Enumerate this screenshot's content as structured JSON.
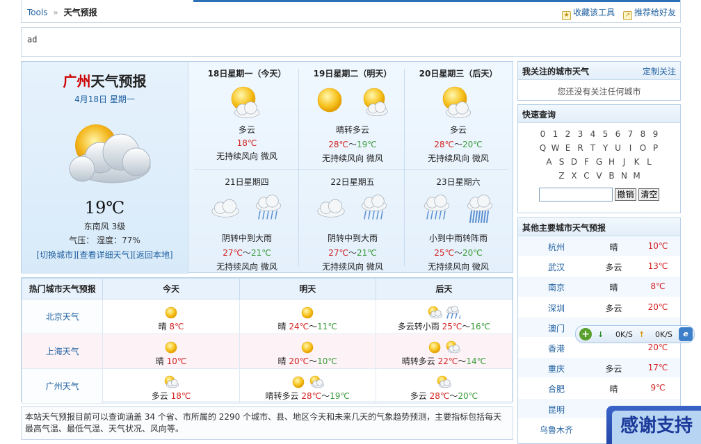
{
  "breadcrumb": {
    "root": "Tools",
    "sep": "»",
    "current": "天气预报"
  },
  "toolbox": {
    "bookmark": "收藏该工具",
    "recommend": "推荐给好友"
  },
  "ad": {
    "text": "ad"
  },
  "today": {
    "city": "广州",
    "title_suffix": "天气预报",
    "date": "4月18日 星期一",
    "icon": "partly-cloudy-icon",
    "temp": "19℃",
    "wind": "东南风 3级",
    "pressure": "气压：",
    "humidity": "湿度：77%",
    "links": "[切换城市][查看详细天气][返回本地]"
  },
  "forecast": [
    {
      "day": "18日星期一（今天）",
      "icon": "sun-cloud",
      "desc": "多云",
      "hi": "18℃",
      "lo": "",
      "wind": "无持续风向 微风"
    },
    {
      "day": "19日星期二（明天）",
      "icon": "sun-and-suncloud",
      "desc": "晴转多云",
      "hi": "28℃",
      "lo": "19℃",
      "wind": "无持续风向 微风"
    },
    {
      "day": "20日星期三（后天）",
      "icon": "sun-cloud",
      "desc": "多云",
      "hi": "28℃",
      "lo": "20℃",
      "wind": "无持续风向 微风"
    },
    {
      "day": "21日星期四",
      "icon": "cloud-rain",
      "desc": "阴转中到大雨",
      "hi": "27℃",
      "lo": "21℃",
      "wind": "无持续风向 微风"
    },
    {
      "day": "22日星期五",
      "icon": "cloud-rain",
      "desc": "阴转中到大雨",
      "hi": "27℃",
      "lo": "21℃",
      "wind": "无持续风向 微风"
    },
    {
      "day": "23日星期六",
      "icon": "rain-heavyrain",
      "desc": "小到中雨转阵雨",
      "hi": "25℃",
      "lo": "20℃",
      "wind": "无持续风向 微风"
    }
  ],
  "hot": {
    "headers": [
      "热门城市天气预报",
      "今天",
      "明天",
      "后天"
    ],
    "rows": [
      {
        "city": "北京天气",
        "today": {
          "desc": "晴",
          "hi": "8℃",
          "lo": ""
        },
        "tomorrow": {
          "desc": "晴",
          "hi": "24℃",
          "lo": "11℃"
        },
        "after": {
          "desc": "多云转小雨",
          "hi": "25℃",
          "lo": "16℃"
        }
      },
      {
        "city": "上海天气",
        "today": {
          "desc": "晴",
          "hi": "10℃",
          "lo": ""
        },
        "tomorrow": {
          "desc": "晴",
          "hi": "20℃",
          "lo": "10℃"
        },
        "after": {
          "desc": "晴转多云",
          "hi": "22℃",
          "lo": "14℃"
        }
      },
      {
        "city": "广州天气",
        "today": {
          "desc": "多云",
          "hi": "18℃",
          "lo": ""
        },
        "tomorrow": {
          "desc": "晴转多云",
          "hi": "28℃",
          "lo": "19℃"
        },
        "after": {
          "desc": "多云",
          "hi": "28℃",
          "lo": "20℃"
        }
      }
    ]
  },
  "note": "本站天气预报目前可以查询涵盖 34 个省、市所属的 2290 个城市、县、地区今天和未来几天的气象趋势预测，主要指标包括每天最高气温、最低气温、天气状况、风向等。",
  "follow": {
    "title": "我关注的城市天气",
    "link": "定制关注",
    "empty": "您还没有关注任何城市"
  },
  "quick": {
    "title": "快速查询",
    "rows": [
      [
        "0",
        "1",
        "2",
        "3",
        "4",
        "5",
        "6",
        "7",
        "8",
        "9"
      ],
      [
        "Q",
        "W",
        "E",
        "R",
        "T",
        "Y",
        "U",
        "I",
        "O",
        "P"
      ],
      [
        "A",
        "S",
        "D",
        "F",
        "G",
        "H",
        "J",
        "K",
        "L"
      ],
      [
        "Z",
        "X",
        "C",
        "V",
        "B",
        "N",
        "M"
      ]
    ],
    "undo": "撤销",
    "clear": "清空"
  },
  "others": {
    "title": "其他主要城市天气预报",
    "rows": [
      {
        "city": "杭州",
        "desc": "晴",
        "temp": "10℃"
      },
      {
        "city": "武汉",
        "desc": "多云",
        "temp": "13℃"
      },
      {
        "city": "南京",
        "desc": "晴",
        "temp": "8℃"
      },
      {
        "city": "深圳",
        "desc": "多云",
        "temp": "20℃"
      },
      {
        "city": "澳门",
        "desc": "",
        "temp": ""
      },
      {
        "city": "香港",
        "desc": "",
        "temp": "20℃"
      },
      {
        "city": "重庆",
        "desc": "多云",
        "temp": "17℃"
      },
      {
        "city": "合肥",
        "desc": "晴",
        "temp": "9℃"
      },
      {
        "city": "昆明",
        "desc": "",
        "temp": ""
      },
      {
        "city": "乌鲁木齐",
        "desc": "",
        "temp": ""
      }
    ]
  },
  "netmeter": {
    "down": "0K/S",
    "up": "0K/S"
  },
  "thanks": "感谢支持",
  "colors": {
    "accent": "#2d6fb5",
    "link": "#2060a0",
    "hot": "#d42222",
    "cold": "#3a9a3a"
  }
}
